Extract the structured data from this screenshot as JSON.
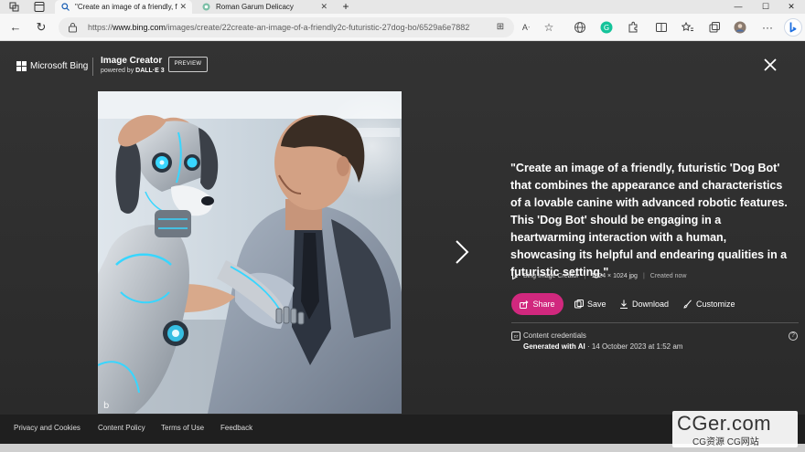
{
  "browser": {
    "tabs": [
      {
        "title": "\"Create an image of a friendly, fu",
        "active": true
      },
      {
        "title": "Roman Garum Delicacy",
        "active": false
      }
    ],
    "new_tab_label": "+",
    "window_controls": {
      "minimize": "—",
      "maximize": "☐",
      "close": "✕"
    },
    "url_prefix": "https://",
    "url_host": "www.bing.com",
    "url_path": "/images/create/22create-an-image-of-a-friendly2c-futuristic-27dog-bo/6529a6e78827..."
  },
  "viewer": {
    "brand": "Microsoft Bing",
    "product_title": "Image Creator",
    "powered_by": "powered by ",
    "powered_by_model": "DALL·E 3",
    "preview_badge": "PREVIEW",
    "prompt": "\"Create an image of a friendly, futuristic 'Dog Bot' that combines the appearance and characteristics of a lovable canine with advanced robotic features. This 'Dog Bot' should be engaging in a heartwarming interaction with a human, showcasing its helpful and endearing qualities in a futuristic setting.\"",
    "meta": {
      "source": "Bing Image Creator",
      "size": "1024 × 1024 jpg",
      "status": "Created now"
    },
    "actions": {
      "share": "Share",
      "save": "Save",
      "download": "Download",
      "customize": "Customize"
    },
    "credentials": {
      "title": "Content credentials",
      "generated_label": "Generated with AI",
      "date_text": " · 14 October 2023 at 1:52 am"
    },
    "help": "?"
  },
  "footer": {
    "links": [
      "Privacy and Cookies",
      "Content Policy",
      "Terms of Use",
      "Feedback"
    ]
  },
  "watermark": {
    "primary": "CGer.com",
    "secondary": "CG资源 CG网站"
  },
  "colors": {
    "share_button": "#d1287e",
    "background": "#2e2e2e",
    "footer": "#1f1f1f",
    "robot_glow": "#38d6ff"
  }
}
